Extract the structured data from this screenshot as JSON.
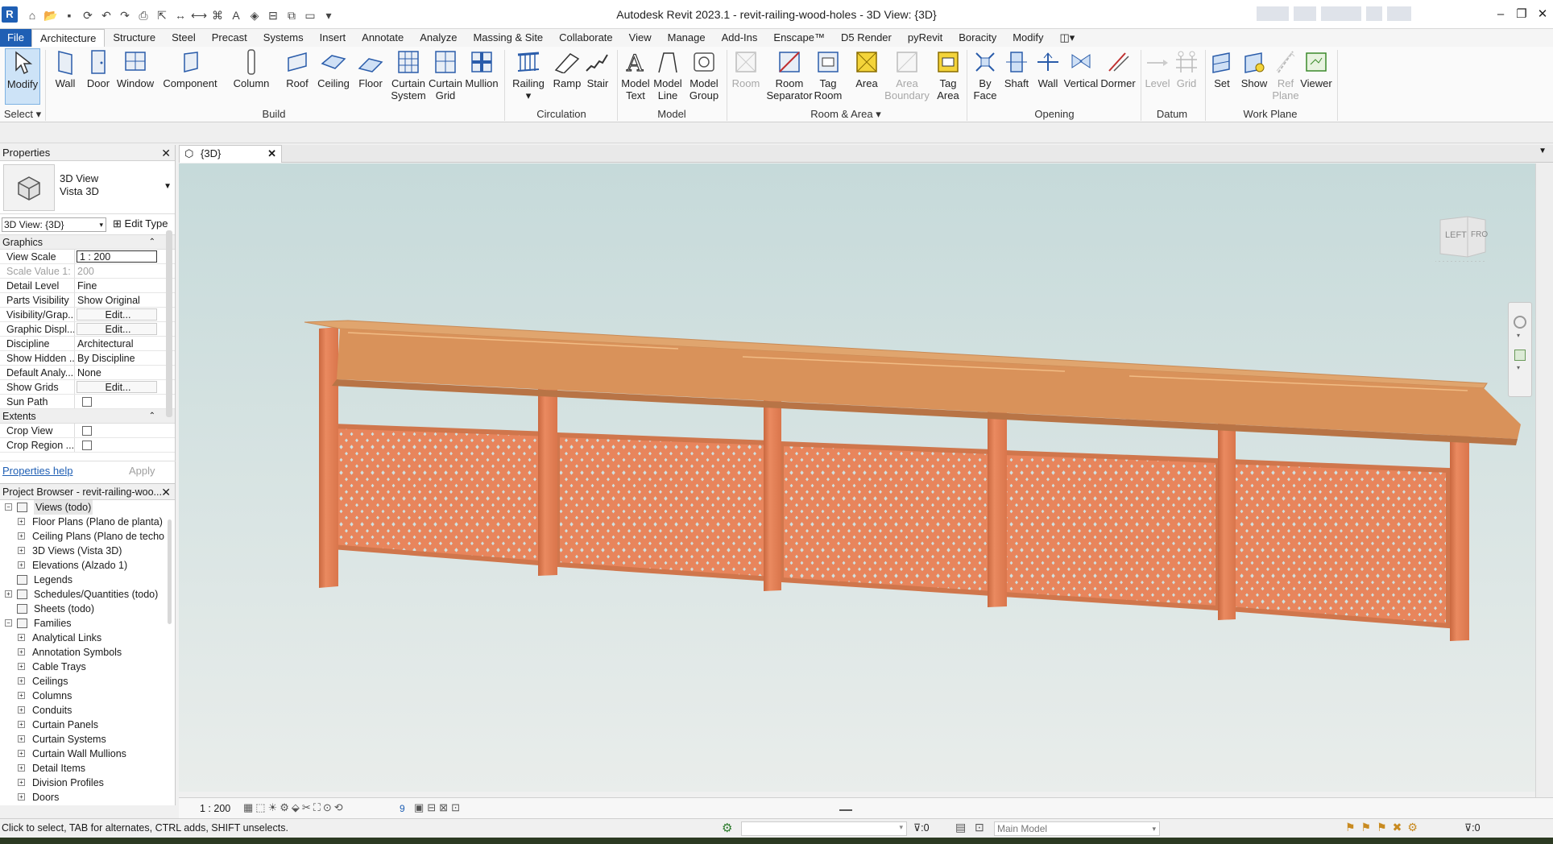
{
  "app": {
    "logo": "R",
    "title": "Autodesk Revit 2023.1 - revit-railing-wood-holes - 3D View: {3D}"
  },
  "tabs": [
    "File",
    "Architecture",
    "Structure",
    "Steel",
    "Precast",
    "Systems",
    "Insert",
    "Annotate",
    "Analyze",
    "Massing & Site",
    "Collaborate",
    "View",
    "Manage",
    "Add-Ins",
    "Enscape™",
    "D5 Render",
    "pyRevit",
    "Boracity",
    "Modify"
  ],
  "active_tab": "Architecture",
  "ribbon": {
    "buttons": {
      "modify": "Modify",
      "wall": "Wall",
      "door": "Door",
      "window": "Window",
      "component": "Component",
      "column": "Column",
      "roof": "Roof",
      "ceiling": "Ceiling",
      "floor": "Floor",
      "curtain_system_1": "Curtain",
      "curtain_system_2": "System",
      "curtain_grid_1": "Curtain",
      "curtain_grid_2": "Grid",
      "mullion": "Mullion",
      "railing": "Railing",
      "ramp": "Ramp",
      "stair": "Stair",
      "model_text_1": "Model",
      "model_text_2": "Text",
      "model_line_1": "Model",
      "model_line_2": "Line",
      "model_group_1": "Model",
      "model_group_2": "Group",
      "room": "Room",
      "room_sep_1": "Room",
      "room_sep_2": "Separator",
      "tag_room_1": "Tag",
      "tag_room_2": "Room",
      "area": "Area",
      "area_boundary_1": "Area",
      "area_boundary_2": "Boundary",
      "tag_area_1": "Tag",
      "tag_area_2": "Area",
      "by_face_1": "By",
      "by_face_2": "Face",
      "shaft": "Shaft",
      "wall_op": "Wall",
      "vertical": "Vertical",
      "dormer": "Dormer",
      "level": "Level",
      "grid": "Grid",
      "set": "Set",
      "show": "Show",
      "ref_plane_1": "Ref",
      "ref_plane_2": "Plane",
      "viewer": "Viewer"
    },
    "panels": {
      "select": "Select",
      "build": "Build",
      "circulation": "Circulation",
      "model": "Model",
      "room_area": "Room & Area",
      "opening": "Opening",
      "datum": "Datum",
      "work_plane": "Work Plane"
    }
  },
  "properties": {
    "header": "Properties",
    "type_line1": "3D View",
    "type_line2": "Vista 3D",
    "view_selector": "3D View: {3D}",
    "edit_type": "Edit Type",
    "sections": {
      "graphics": "Graphics",
      "extents": "Extents"
    },
    "rows": [
      {
        "key": "View Scale",
        "value": "1 : 200"
      },
      {
        "key": "Scale Value    1:",
        "value": "200"
      },
      {
        "key": "Detail Level",
        "value": "Fine"
      },
      {
        "key": "Parts Visibility",
        "value": "Show Original"
      },
      {
        "key": "Visibility/Grap...",
        "value": "Edit..."
      },
      {
        "key": "Graphic Displ...",
        "value": "Edit..."
      },
      {
        "key": "Discipline",
        "value": "Architectural"
      },
      {
        "key": "Show Hidden ...",
        "value": "By Discipline"
      },
      {
        "key": "Default Analy...",
        "value": "None"
      },
      {
        "key": "Show Grids",
        "value": "Edit..."
      },
      {
        "key": "Sun Path",
        "value": ""
      },
      {
        "key": "Crop View",
        "value": ""
      },
      {
        "key": "Crop Region ...",
        "value": ""
      }
    ],
    "help_link": "Properties help",
    "apply": "Apply"
  },
  "browser": {
    "header": "Project Browser - revit-railing-woo...",
    "items": [
      {
        "label": "Views (todo)",
        "level": 0
      },
      {
        "label": "Floor Plans (Plano de planta)",
        "level": 1
      },
      {
        "label": "Ceiling Plans (Plano de techo",
        "level": 1
      },
      {
        "label": "3D Views (Vista 3D)",
        "level": 1
      },
      {
        "label": "Elevations (Alzado 1)",
        "level": 1
      },
      {
        "label": "Legends",
        "level": 0
      },
      {
        "label": "Schedules/Quantities (todo)",
        "level": 0
      },
      {
        "label": "Sheets (todo)",
        "level": 0
      },
      {
        "label": "Families",
        "level": 0
      },
      {
        "label": "Analytical Links",
        "level": 1
      },
      {
        "label": "Annotation Symbols",
        "level": 1
      },
      {
        "label": "Cable Trays",
        "level": 1
      },
      {
        "label": "Ceilings",
        "level": 1
      },
      {
        "label": "Columns",
        "level": 1
      },
      {
        "label": "Conduits",
        "level": 1
      },
      {
        "label": "Curtain Panels",
        "level": 1
      },
      {
        "label": "Curtain Systems",
        "level": 1
      },
      {
        "label": "Curtain Wall Mullions",
        "level": 1
      },
      {
        "label": "Detail Items",
        "level": 1
      },
      {
        "label": "Division Profiles",
        "level": 1
      },
      {
        "label": "Doors",
        "level": 1
      }
    ]
  },
  "view_tab": "{3D}",
  "viewcube": {
    "left": "LEFT",
    "front": "FRO"
  },
  "view_control": {
    "scale": "1 : 200",
    "crop_count": "9"
  },
  "status": {
    "hint": "Click to select, TAB for alternates, CTRL adds, SHIFT unselects.",
    "selection_count": ":0",
    "model": "Main Model",
    "filter_count": ":0"
  },
  "colors": {
    "accent": "#1f5fb4",
    "wood": "#e8855c",
    "wood_dark": "#c9683f",
    "rail_top": "#d99a62",
    "sky_top": "#c9dcdc",
    "sky_bottom": "#e8ecea"
  }
}
